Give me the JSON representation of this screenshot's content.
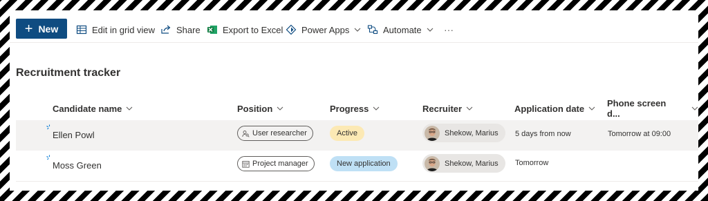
{
  "toolbar": {
    "new_label": "New",
    "edit_grid_label": "Edit in grid view",
    "share_label": "Share",
    "export_label": "Export to Excel",
    "power_apps_label": "Power Apps",
    "automate_label": "Automate",
    "more_label": "···"
  },
  "list": {
    "title": "Recruitment tracker",
    "columns": [
      "Candidate name",
      "Position",
      "Progress",
      "Recruiter",
      "Application date",
      "Phone screen d..."
    ],
    "rows": [
      {
        "candidate": "Ellen Powl",
        "position": "User researcher",
        "position_icon": "person-search-icon",
        "progress": "Active",
        "progress_color": "#fce9b4",
        "recruiter": "Shekow, Marius",
        "application_date": "5 days from now",
        "phone_screen": "Tomorrow at 09:00"
      },
      {
        "candidate": "Moss Green",
        "position": "Project manager",
        "position_icon": "calendar-icon",
        "progress": "New application",
        "progress_color": "#bfe0f5",
        "recruiter": "Shekow, Marius",
        "application_date": "Tomorrow",
        "phone_screen": ""
      }
    ]
  },
  "colors": {
    "primary": "#0f4c81",
    "excel_green": "#107c41",
    "new_item_blue": "#0078d4"
  }
}
